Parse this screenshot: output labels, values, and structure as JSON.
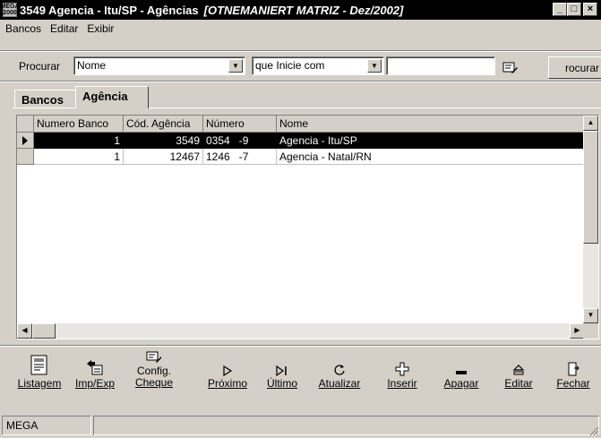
{
  "window": {
    "icon_text_top": "MEGA",
    "icon_text_bottom": "2000",
    "title": "3549 Agencia - Itu/SP -  Agências",
    "title_italic": "[OTNEMANIERT MATRIZ - Dez/2002]",
    "btn_minimize": "_",
    "btn_maximize": "□",
    "btn_close": "×"
  },
  "menu": {
    "items": [
      "Bancos",
      "Editar",
      "Exibir"
    ]
  },
  "search": {
    "label": "Procurar",
    "field_value": "Nome",
    "mode_value": "que Inicie com",
    "text_value": "",
    "button_label": "rocurar"
  },
  "tabs": [
    {
      "label": "Bancos",
      "active": false
    },
    {
      "label": "Agência",
      "active": true
    }
  ],
  "grid": {
    "columns": [
      "Numero Banco",
      "Cód. Agência",
      "Número",
      "Nome"
    ],
    "rows": [
      {
        "banco": "1",
        "agencia": "3549",
        "numero": "0354   -9",
        "nome": "Agencia - Itu/SP",
        "selected": true
      },
      {
        "banco": "1",
        "agencia": "12467",
        "numero": "1246   -7",
        "nome": "Agencia - Natal/RN",
        "selected": false
      }
    ]
  },
  "toolbar": {
    "buttons": [
      {
        "line1": "Listagem",
        "line2": "",
        "icon": "list-report-icon"
      },
      {
        "line1": "Imp/Exp",
        "line2": "",
        "icon": "import-export-icon"
      },
      {
        "line1": "Config.",
        "line2": "Cheque",
        "icon": "config-cheque-icon"
      },
      {
        "line1": "Próximo",
        "line2": "",
        "icon": "next-icon"
      },
      {
        "line1": "Último",
        "line2": "",
        "icon": "last-icon"
      },
      {
        "line1": "Atualizar",
        "line2": "",
        "icon": "refresh-icon"
      },
      {
        "line1": "Inserir",
        "line2": "",
        "icon": "insert-icon"
      },
      {
        "line1": "Apagar",
        "line2": "",
        "icon": "delete-icon"
      },
      {
        "line1": "Editar",
        "line2": "",
        "icon": "edit-icon"
      },
      {
        "line1": "Fechar",
        "line2": "",
        "icon": "close-door-icon"
      }
    ]
  },
  "status": {
    "panel1": "MEGA"
  }
}
